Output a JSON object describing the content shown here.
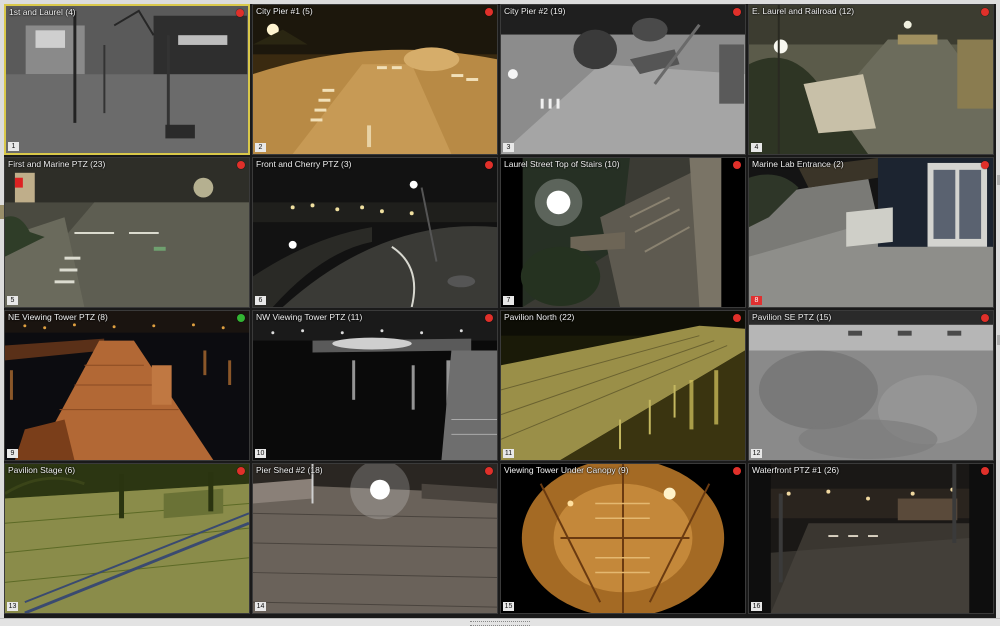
{
  "cameras": [
    {
      "title": "1st and Laurel (4)",
      "num": "1",
      "status": "red"
    },
    {
      "title": "City Pier #1 (5)",
      "num": "2",
      "status": "red"
    },
    {
      "title": "City Pier #2 (19)",
      "num": "3",
      "status": "red"
    },
    {
      "title": "E. Laurel and Railroad (12)",
      "num": "4",
      "status": "red"
    },
    {
      "title": "First and Marine PTZ (23)",
      "num": "5",
      "status": "red"
    },
    {
      "title": "Front and Cherry PTZ (3)",
      "num": "6",
      "status": "red"
    },
    {
      "title": "Laurel Street Top of Stairs (10)",
      "num": "7",
      "status": "red"
    },
    {
      "title": "Marine Lab Entrance (2)",
      "num": "8",
      "status": "red"
    },
    {
      "title": "NE Viewing Tower PTZ (8)",
      "num": "9",
      "status": "green"
    },
    {
      "title": "NW Viewing Tower PTZ (11)",
      "num": "10",
      "status": "red"
    },
    {
      "title": "Pavilion North (22)",
      "num": "11",
      "status": "red"
    },
    {
      "title": "Pavilion SE PTZ (15)",
      "num": "12",
      "status": "red"
    },
    {
      "title": "Pavilion Stage (6)",
      "num": "13",
      "status": "red"
    },
    {
      "title": "Pier Shed #2 (18)",
      "num": "14",
      "status": "red"
    },
    {
      "title": "Viewing Tower Under Canopy (9)",
      "num": "15",
      "status": "red"
    },
    {
      "title": "Waterfront PTZ #1 (26)",
      "num": "16",
      "status": "red"
    }
  ],
  "colors": {
    "recording_red": "#e0302a",
    "live_green": "#33b533",
    "selected_border": "#d9c84a"
  }
}
